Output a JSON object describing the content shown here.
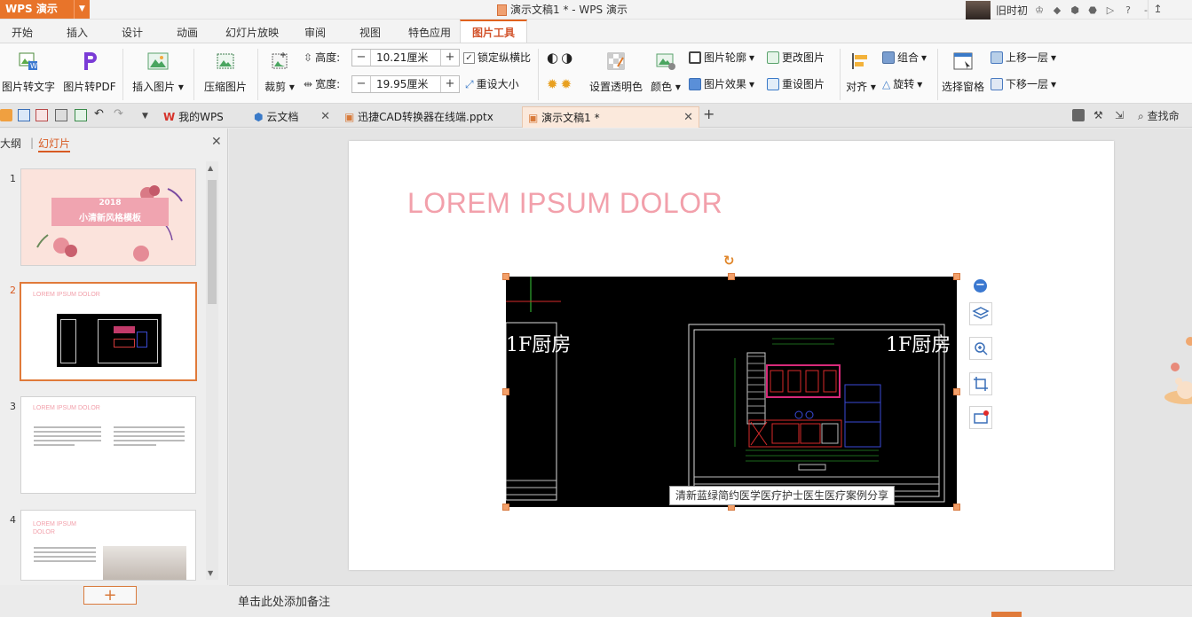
{
  "titlebar": {
    "app_name": "WPS 演示",
    "document_title": "演示文稿1 * - WPS 演示",
    "username": "旧时初"
  },
  "ribbon_tabs": [
    "开始",
    "插入",
    "设计",
    "动画",
    "幻灯片放映",
    "审阅",
    "视图",
    "特色应用",
    "图片工具"
  ],
  "ribbon": {
    "img_to_text": "图片转文字",
    "img_to_pdf": "图片转PDF",
    "insert_image": "插入图片",
    "compress": "压缩图片",
    "crop": "裁剪",
    "height_label": "高度:",
    "height_value": "10.21厘米",
    "width_label": "宽度:",
    "width_value": "19.95厘米",
    "lock_ratio": "锁定纵横比",
    "reset_size": "重设大小",
    "set_transparent": "设置透明色",
    "color": "颜色",
    "outline": "图片轮廓",
    "effect": "图片效果",
    "change_image": "更改图片",
    "reset_image": "重设图片",
    "align": "对齐",
    "group": "组合",
    "rotate": "旋转",
    "selection_pane": "选择窗格",
    "bring_forward": "上移一层",
    "send_backward": "下移一层"
  },
  "doc_tabs": [
    {
      "label": "我的WPS"
    },
    {
      "label": "云文档"
    },
    {
      "label": "迅捷CAD转换器在线端.pptx"
    },
    {
      "label": "演示文稿1 *"
    }
  ],
  "find_label": "查找命",
  "left_panel": {
    "tab_outline": "大纲",
    "tab_slides": "幻灯片",
    "slide_numbers": [
      "1",
      "2",
      "3",
      "4"
    ],
    "thumb1": {
      "year": "2018",
      "title": "小清新风格模板"
    },
    "thumb2": {
      "title": "LOREM IPSUM DOLOR"
    },
    "thumb3": {
      "title": "LOREM IPSUM DOLOR"
    },
    "thumb4": {
      "title": "LOREM IPSUM DOLOR"
    }
  },
  "slide": {
    "title": "LOREM IPSUM DOLOR",
    "cad_label_left": "1F厨房",
    "cad_label_right": "1F厨房",
    "image_caption": "清新蓝绿简约医学医疗护士医生医疗案例分享"
  },
  "notes_placeholder": "单击此处添加备注",
  "colors": {
    "accent": "#e0621e",
    "title_pink": "#f2a0ab"
  }
}
